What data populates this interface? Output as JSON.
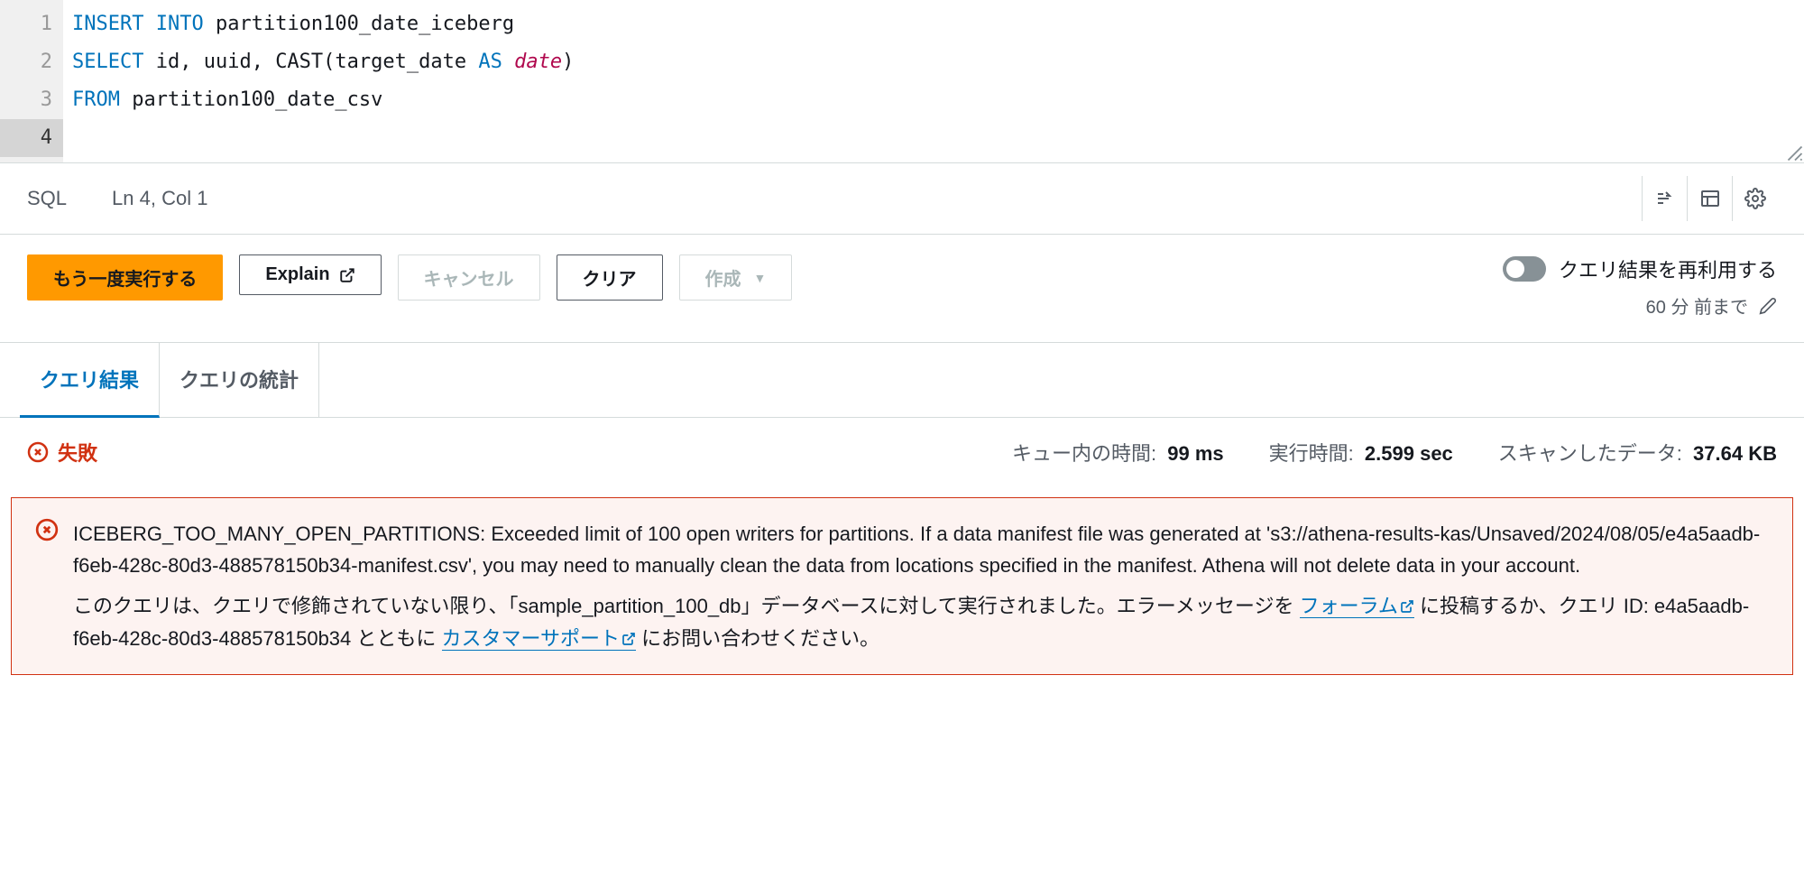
{
  "editor": {
    "line_numbers": [
      "1",
      "2",
      "3",
      "4"
    ],
    "active_line_idx": 3,
    "sql": {
      "l1_kw1": "INSERT",
      "l1_kw2": "INTO",
      "l1_tbl": "partition100_date_iceberg",
      "l2_kw1": "SELECT",
      "l2_cols": "id, uuid, ",
      "l2_fn": "CAST",
      "l2_open": "(",
      "l2_col": "target_date ",
      "l2_as": "AS ",
      "l2_type": "date",
      "l2_close": ")",
      "l3_kw": "FROM",
      "l3_tbl": "partition100_date_csv"
    }
  },
  "statusbar": {
    "lang": "SQL",
    "pos": "Ln 4, Col 1"
  },
  "actions": {
    "run_again": "もう一度実行する",
    "explain": "Explain",
    "cancel": "キャンセル",
    "clear": "クリア",
    "create": "作成",
    "reuse_label": "クエリ結果を再利用する",
    "age_label": "60 分 前まで"
  },
  "tabs": {
    "results": "クエリ結果",
    "stats": "クエリの統計"
  },
  "summary": {
    "status": "失敗",
    "queue_label": "キュー内の時間:",
    "queue_value": "99 ms",
    "exec_label": "実行時間:",
    "exec_value": "2.599 sec",
    "scan_label": "スキャンしたデータ:",
    "scan_value": "37.64 KB"
  },
  "error": {
    "message": "ICEBERG_TOO_MANY_OPEN_PARTITIONS: Exceeded limit of 100 open writers for partitions. If a data manifest file was generated at 's3://athena-results-kas/Unsaved/2024/08/05/e4a5aadb-f6eb-428c-80d3-488578150b34-manifest.csv', you may need to manually clean the data from locations specified in the manifest. Athena will not delete data in your account.",
    "hint_pre": "このクエリは、クエリで修飾されていない限り、「sample_partition_100_db」データベースに対して実行されました。エラーメッセージを ",
    "forum_link": "フォーラム",
    "hint_mid1": " に投稿するか、クエリ ID: e4a5aadb-f6eb-428c-80d3-488578150b34 とともに ",
    "support_link": "カスタマーサポート",
    "hint_post": " にお問い合わせください。"
  }
}
